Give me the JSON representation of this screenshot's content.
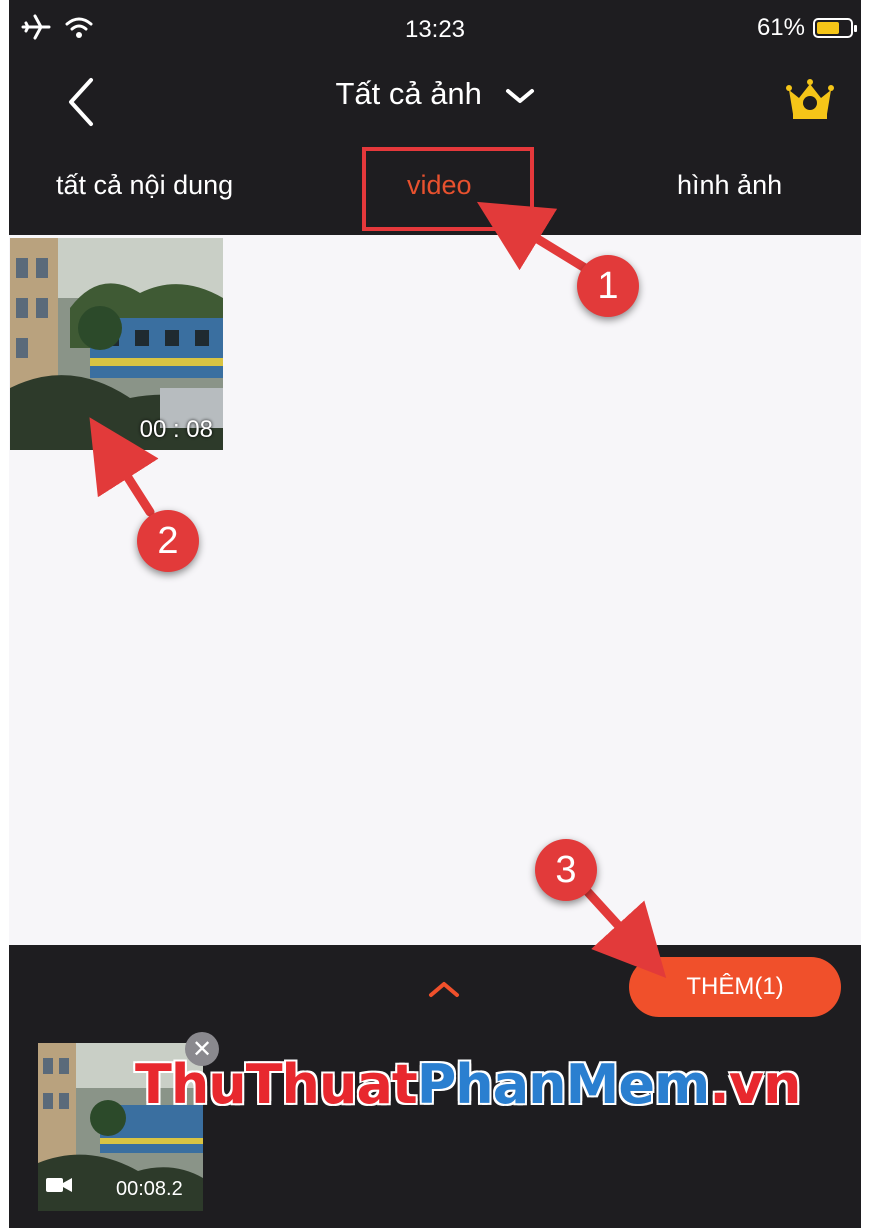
{
  "status": {
    "time": "13:23",
    "battery": "61%",
    "battery_level": 0.61
  },
  "nav": {
    "title": "Tất cả ảnh"
  },
  "tabs": [
    {
      "label": "tất cả nội dung",
      "active": false
    },
    {
      "label": "video",
      "active": true
    },
    {
      "label": "hình ảnh",
      "active": false
    }
  ],
  "grid": {
    "items": [
      {
        "duration": "00 : 08"
      }
    ]
  },
  "bottom": {
    "add_label": "THÊM(1)",
    "selected": [
      {
        "duration": "00:08.2"
      }
    ]
  },
  "watermark": {
    "part1": "ThuThuat",
    "part2": "PhanMem",
    "part3": ".vn"
  },
  "annotations": [
    "1",
    "2",
    "3"
  ],
  "colors": {
    "accent": "#f0502b",
    "annotation": "#e23a3a",
    "bar": "#1e1d20"
  }
}
